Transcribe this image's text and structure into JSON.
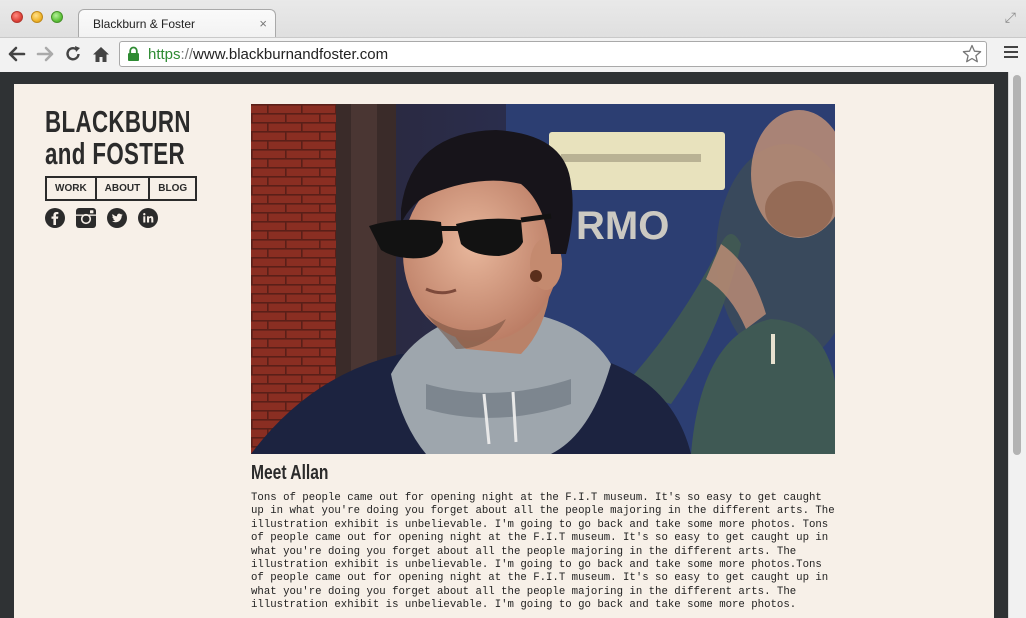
{
  "browser": {
    "tab_title": "Blackburn & Foster",
    "tab_close": "×",
    "url_scheme": "https",
    "url_separator": "://",
    "url_host": "www.blackburnandfoster.com"
  },
  "site": {
    "logo_line1": "BLACKBURN",
    "logo_line2": "and FOSTER",
    "nav": [
      "WORK",
      "ABOUT",
      "BLOG"
    ],
    "social_icons": [
      "facebook-icon",
      "instagram-icon",
      "twitter-icon",
      "linkedin-icon"
    ]
  },
  "article": {
    "title": "Meet Allan",
    "body": "Tons of people came out for opening night at the F.I.T museum. It's so easy to get caught up in what you're doing you forget about all the people majoring in the different arts. The illustration exhibit is unbelievable. I'm going to go back and take some more photos. Tons of people came out for opening night at the F.I.T museum. It's so easy to get caught up in what you're doing you forget about all the people majoring in the different arts. The illustration exhibit is unbelievable. I'm going to go back and take some more photos.Tons of people came out for opening night at the F.I.T museum. It's so easy to get caught up in what you're doing you forget about all the people majoring in the different arts. The illustration exhibit is unbelievable. I'm going to go back and take some more photos."
  },
  "colors": {
    "page_background": "#f7f0e8",
    "frame": "#2f3234",
    "text": "#2b2b2b",
    "url_scheme": "#2e8b32"
  }
}
